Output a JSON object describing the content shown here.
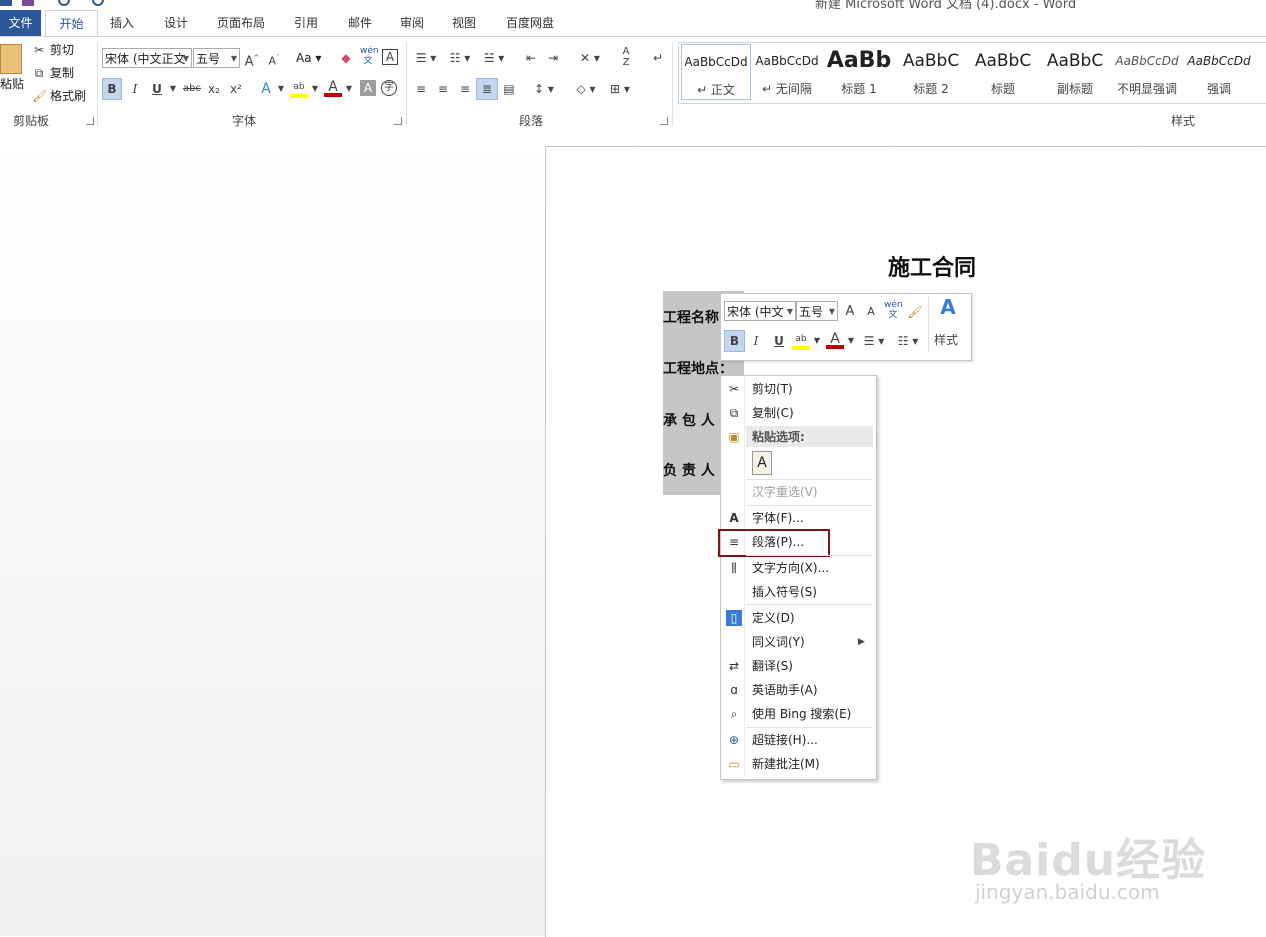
{
  "window": {
    "title": "新建 Microsoft Word 文档 (4).docx - Word"
  },
  "tabs": [
    {
      "label": "文件"
    },
    {
      "label": "开始"
    },
    {
      "label": "插入"
    },
    {
      "label": "设计"
    },
    {
      "label": "页面布局"
    },
    {
      "label": "引用"
    },
    {
      "label": "邮件"
    },
    {
      "label": "审阅"
    },
    {
      "label": "视图"
    },
    {
      "label": "百度网盘"
    }
  ],
  "active_tab": "开始",
  "ribbon": {
    "clipboard": {
      "paste": "粘贴",
      "cut": "剪切",
      "copy": "复制",
      "format_painter": "格式刷",
      "group": "剪贴板"
    },
    "font": {
      "font_name": "宋体 (中文正文",
      "font_size": "五号",
      "change_case": "Aa",
      "group": "字体",
      "pinyin": "wén",
      "bold": "B",
      "italic": "I",
      "underline": "U",
      "strike": "abc",
      "sub": "x₂",
      "sup": "x²",
      "font_color_letter": "A"
    },
    "paragraph": {
      "group": "段落"
    },
    "styles": {
      "group": "样式",
      "items": [
        {
          "sample": "AaBbCcDd",
          "name": "↵ 正文"
        },
        {
          "sample": "AaBbCcDd",
          "name": "↵ 无间隔"
        },
        {
          "sample": "AaBb",
          "name": "标题 1"
        },
        {
          "sample": "AaBbC",
          "name": "标题 2"
        },
        {
          "sample": "AaBbC",
          "name": "标题"
        },
        {
          "sample": "AaBbC",
          "name": "副标题"
        },
        {
          "sample": "AaBbCcDd",
          "name": "不明显强调"
        },
        {
          "sample": "AaBbCcDd",
          "name": "强调"
        }
      ]
    }
  },
  "document": {
    "title": "施工合同",
    "lines": [
      "工程名称",
      "工程地点：",
      "承 包 人",
      "负 责 人"
    ]
  },
  "mini_toolbar": {
    "font_name": "宋体 (中文",
    "font_size": "五号",
    "styles_label": "样式",
    "bold": "B",
    "italic": "I",
    "underline": "U",
    "pinyin": "wén"
  },
  "context_menu": {
    "items": [
      {
        "label": "剪切(T)",
        "icon": "scissors-icon"
      },
      {
        "label": "复制(C)",
        "icon": "copy-icon"
      },
      {
        "label": "粘贴选项:",
        "icon": "paste-icon"
      },
      {
        "label": "汉字重选(V)",
        "icon": ""
      },
      {
        "label": "字体(F)...",
        "icon": "font-icon"
      },
      {
        "label": "段落(P)...",
        "icon": "paragraph-icon"
      },
      {
        "label": "文字方向(X)...",
        "icon": "text-direction-icon"
      },
      {
        "label": "插入符号(S)",
        "icon": ""
      },
      {
        "label": "定义(D)",
        "icon": "define-icon"
      },
      {
        "label": "同义词(Y)",
        "icon": ""
      },
      {
        "label": "翻译(S)",
        "icon": "translate-icon"
      },
      {
        "label": "英语助手(A)",
        "icon": "english-assistant-icon"
      },
      {
        "label": "使用 Bing 搜索(E)",
        "icon": "bing-search-icon"
      },
      {
        "label": "超链接(H)...",
        "icon": "hyperlink-icon"
      },
      {
        "label": "新建批注(M)",
        "icon": "new-comment-icon"
      }
    ],
    "highlighted": "段落(P)..."
  },
  "watermark": {
    "logo": "Baidu经验",
    "url": "jingyan.baidu.com"
  },
  "colors": {
    "file_tab": "#2b579a",
    "highlight_box": "#7b1518",
    "font_color_bar": "#c00000",
    "highlight_color_bar": "#ffff00"
  }
}
